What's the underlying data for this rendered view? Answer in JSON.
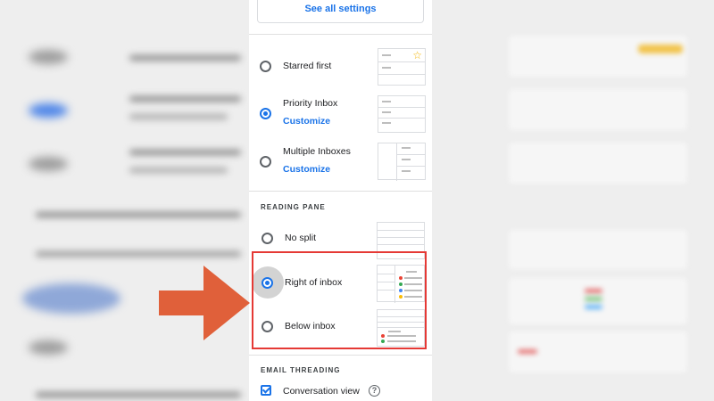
{
  "settings": {
    "see_all": "See all settings",
    "inbox_options": [
      {
        "label": "Starred first",
        "selected": false,
        "thumb": "starred"
      },
      {
        "label": "Priority Inbox",
        "link": "Customize",
        "selected": true,
        "thumb": "priority"
      },
      {
        "label": "Multiple Inboxes",
        "link": "Customize",
        "selected": false,
        "thumb": "multiple"
      }
    ],
    "reading_pane": {
      "title": "READING PANE",
      "options": [
        {
          "label": "No split",
          "selected": false
        },
        {
          "label": "Right of inbox",
          "selected": true
        },
        {
          "label": "Below inbox",
          "selected": false
        }
      ]
    },
    "email_threading": {
      "title": "EMAIL THREADING",
      "conversation_view": {
        "label": "Conversation view",
        "checked": true
      },
      "help_glyph": "?"
    }
  },
  "annotation": {
    "arrow_color": "#e0603a",
    "highlight_color": "#e53935"
  },
  "colors": {
    "accent": "#1a73e8",
    "star": "#f4b400",
    "dot_red": "#ea4335",
    "dot_green": "#34a853",
    "dot_blue": "#4285f4",
    "dot_yellow": "#fbbc04"
  }
}
